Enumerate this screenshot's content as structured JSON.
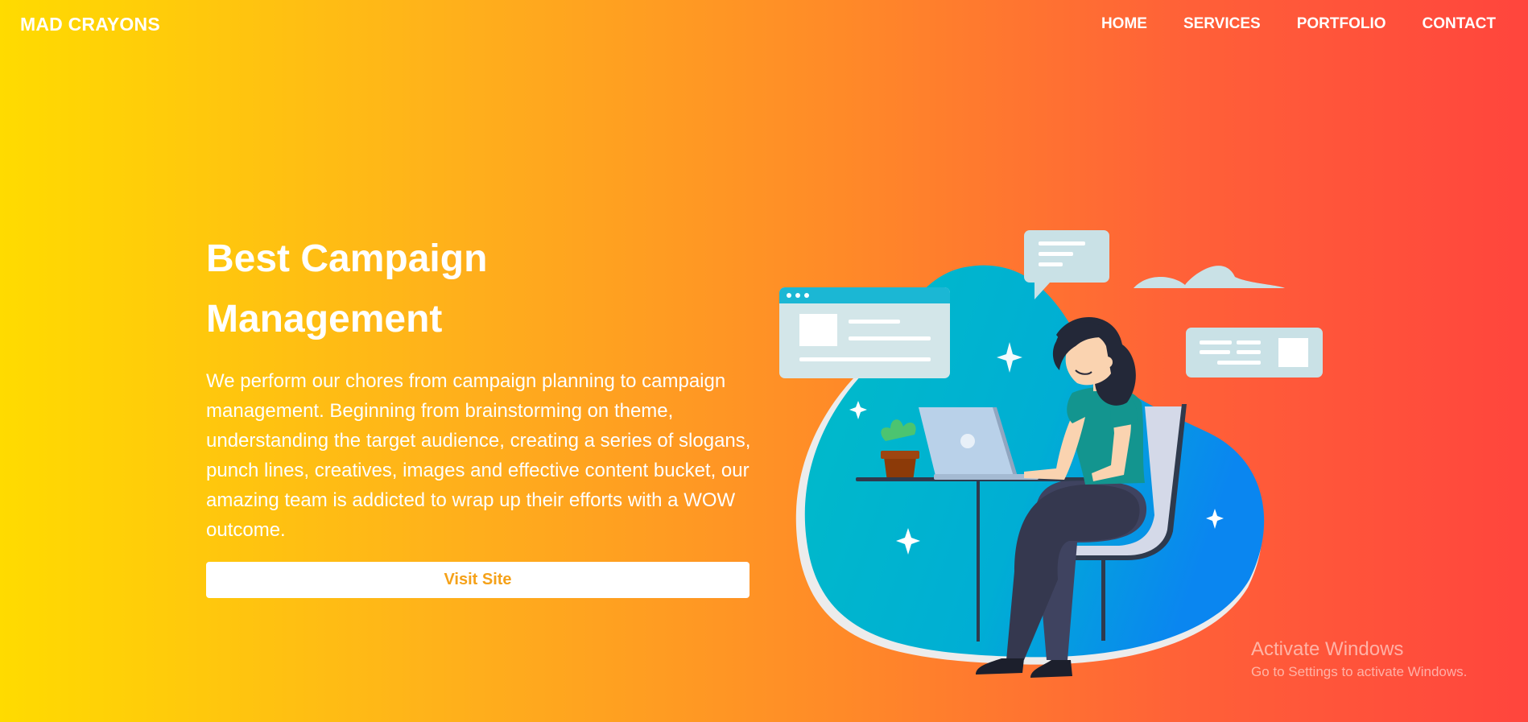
{
  "brand": "MAD CRAYONS",
  "nav": {
    "items": [
      {
        "label": "HOME"
      },
      {
        "label": "SERVICES"
      },
      {
        "label": "PORTFOLIO"
      },
      {
        "label": "CONTACT"
      }
    ]
  },
  "hero": {
    "title_line1": "Best Campaign",
    "title_line2": "Management",
    "description": "We perform our chores from campaign planning to campaign management. Beginning from brainstorming on theme, understanding the target audience, creating a series of slogans, punch lines, creatives, images and effective content bucket, our amazing team is addicted to wrap up their efforts with a WOW outcome.",
    "button_label": "Visit Site"
  },
  "watermark": {
    "title": "Activate Windows",
    "subtitle": "Go to Settings to activate Windows."
  },
  "colors": {
    "gradient_start": "#ffdb00",
    "gradient_end": "#ff453d",
    "button_text": "#f5a118",
    "blob_teal": "#00bcc8",
    "blob_blue": "#0a86f0"
  },
  "illustration": {
    "subject": "woman-working-on-laptop-illustration"
  }
}
